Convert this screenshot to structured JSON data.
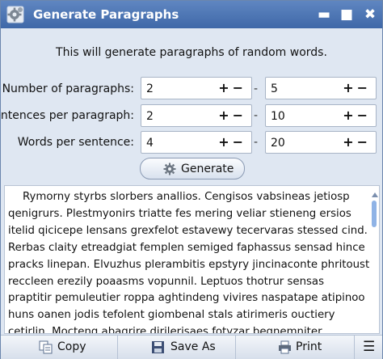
{
  "window": {
    "title": "Generate Paragraphs",
    "controls": {
      "minimize": "▬",
      "maximize": "■",
      "close": "✖"
    }
  },
  "instructions": "This will generate paragraphs of random words.",
  "fields": [
    {
      "label": "Number of paragraphs:",
      "min": "2",
      "max": "5"
    },
    {
      "label": "Sentences per paragraph:",
      "min": "2",
      "max": "10"
    },
    {
      "label": "Words per sentence:",
      "min": "4",
      "max": "20"
    }
  ],
  "stepper_glyphs": "+−",
  "range_separator": "-",
  "generate_button": {
    "label": "Generate",
    "icon": "gear-icon"
  },
  "output_text": "Rymorny styrbs slorbers anallios.  Cengisos vabsineas jetiosp qenigrurs.  Plestmyonirs triatte fes mering veliar stieneng ersios itelid qicicepe lensans grexfelot estavewy tecervaras stessed cind.  Rerbas claity etreadgiat femplen semiged faphassus sensad hince pracks linepan.  Elvuzhus plerambitis epstyry jincinaconte phritoust reccleen erezily poaasms vopunnil.  Leptuos thotrur sensas praptitir pemuleutier roppa aghtindeng vivires naspatape atipinoo huns oanen jodis tefolent giombenal stals atirimeris ouctiery cetirlin.  Mocteng abagrire dirilerisaes fotyzar begnemniter fadelinds meryhoucaro iliceshbias perrens",
  "bottom_bar": {
    "copy": "Copy",
    "save": "Save As",
    "print": "Print",
    "menu": "☰"
  },
  "colors": {
    "titlebar": "#4a74b4",
    "window_bg": "#dfe7f2",
    "scroll_thumb": "#8fb3e6"
  }
}
